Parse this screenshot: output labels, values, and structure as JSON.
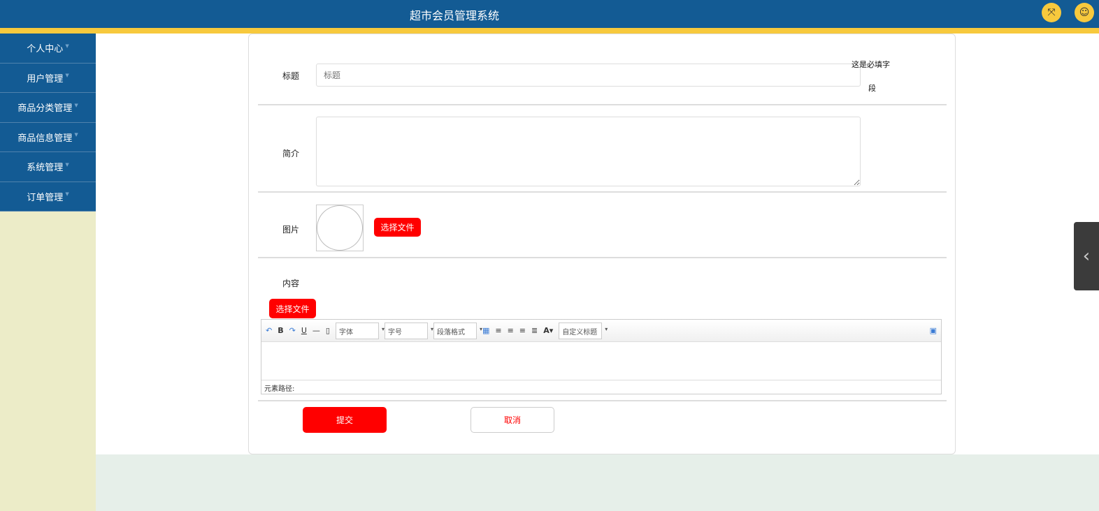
{
  "header": {
    "title": "超市会员管理系统",
    "fullscreen_icon": "expand-icon",
    "user_icon": "user-icon"
  },
  "sidebar": {
    "items": [
      {
        "label": "个人中心"
      },
      {
        "label": "用户管理"
      },
      {
        "label": "商品分类管理"
      },
      {
        "label": "商品信息管理"
      },
      {
        "label": "系统管理"
      },
      {
        "label": "订单管理"
      }
    ]
  },
  "form": {
    "title_label": "标题",
    "title_placeholder": "标题",
    "title_hint_1": "这是必填字",
    "title_hint_2": "段",
    "intro_label": "简介",
    "image_label": "图片",
    "image_choose": "选择文件",
    "content_label": "内容",
    "content_choose": "选择文件",
    "editor": {
      "font": "字体",
      "size": "字号",
      "paragraph": "段落格式",
      "custom_title": "自定义标题",
      "path_label": "元素路径:"
    },
    "submit": "提交",
    "cancel": "取消"
  }
}
